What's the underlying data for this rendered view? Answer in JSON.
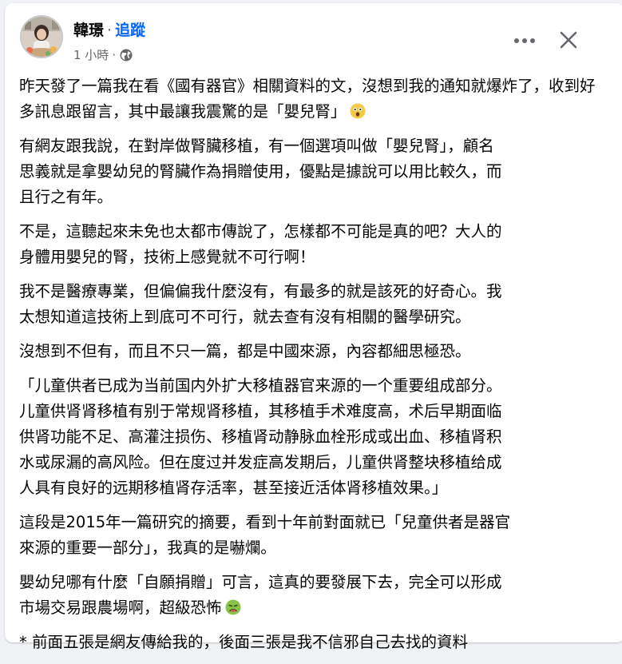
{
  "author": {
    "name": "韓璟",
    "separator": "·",
    "follow_label": "追蹤",
    "avatar_icon": "profile-photo"
  },
  "meta": {
    "time": "1 小時",
    "separator": "·",
    "audience_icon": "globe-icon"
  },
  "header_actions": {
    "more_icon": "more-horizontal-icon",
    "close_icon": "close-icon"
  },
  "post": {
    "paragraphs": [
      "昨天發了一篇我在看《國有器官》相關資料的文，沒想到我的通知就爆炸了，收到好多訊息跟留言，其中最讓我震驚的是「嬰兒腎」",
      "有網友跟我說，在對岸做腎臟移植，有一個選項叫做「嬰兒腎」，顧名\n思義就是拿嬰幼兒的腎臟作為捐贈使用，優點是據說可以用比較久，而\n且行之有年。",
      "不是，這聽起來未免也太都市傳說了，怎樣都不可能是真的吧？大人的\n身體用嬰兒的腎，技術上感覺就不可行啊！",
      "我不是醫療專業，但偏偏我什麼沒有，有最多的就是該死的好奇心。我\n太想知道這技術上到底可不可行，就去查有沒有相關的醫學研究。",
      "沒想到不但有，而且不只一篇，都是中國來源，內容都細思極恐。",
      "「儿童供者已成为当前国内外扩大移植器官来源的一个重要组成部分。\n儿童供肾肾移植有别于常规肾移植，其移植手术难度高，术后早期面临\n供肾功能不足、高灌注损伤、移植肾动静脉血栓形成或出血、移植肾积\n水或尿漏的高风险。但在度过并发症高发期后，儿童供肾整块移植给成\n人具有良好的远期移植肾存活率，甚至接近活体肾移植效果。」",
      "這段是2015年一篇研究的摘要，看到十年前對面就已「兒童供者是器官\n來源的重要一部分」，我真的是嚇爛。",
      "嬰幼兒哪有什麼「自願捐贈」可言，這真的要發展下去，完全可以形成\n市場交易跟農場啊，超級恐怖",
      " * 前面五張是網友傳給我的，後面三張是我不信邪自己去找的資料"
    ],
    "emojis": [
      "astonished-face-emoji",
      "nauseated-face-emoji"
    ]
  },
  "colors": {
    "link": "#0866ff",
    "text": "#050505",
    "secondary": "#65676b",
    "background": "#f0f2f5",
    "card": "#ffffff"
  }
}
